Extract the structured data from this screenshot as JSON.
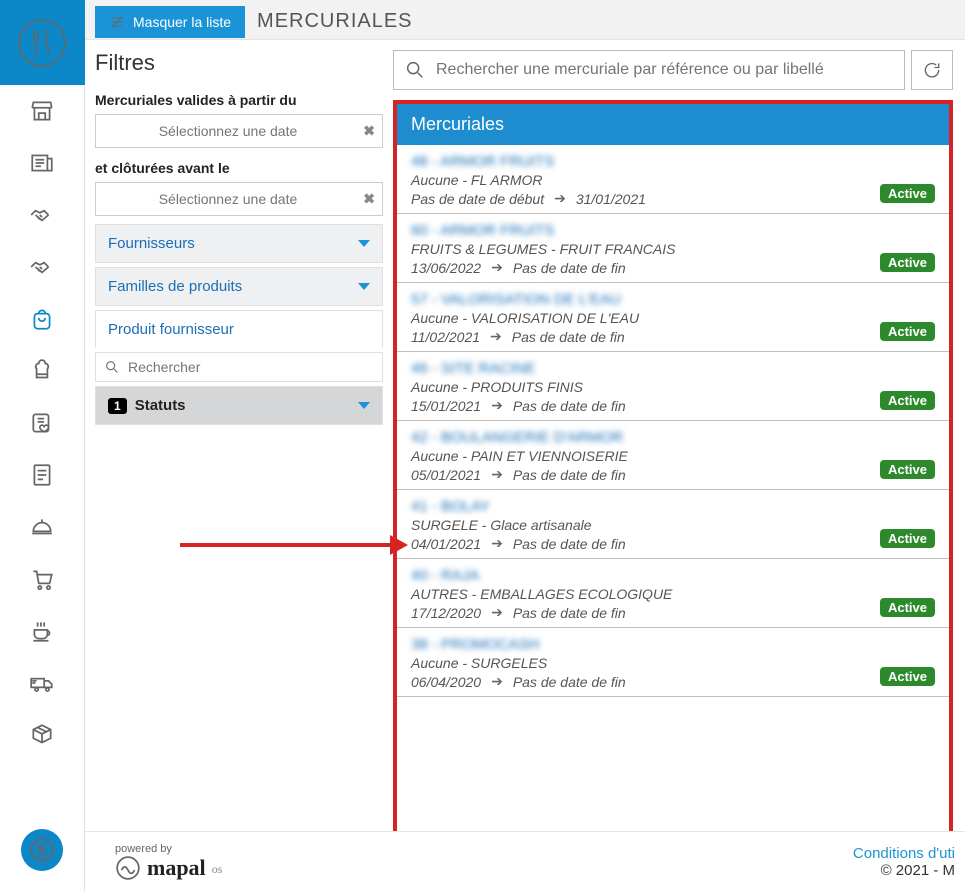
{
  "topbar": {
    "hide_list_label": "Masquer la liste",
    "page_title": "MERCURIALES"
  },
  "filters": {
    "heading": "Filtres",
    "valid_from_label": "Mercuriales valides à partir du",
    "valid_from_placeholder": "Sélectionnez une date",
    "closed_before_label": "et clôturées avant le",
    "closed_before_placeholder": "Sélectionnez une date",
    "suppliers_label": "Fournisseurs",
    "families_label": "Familles de produits",
    "supplier_product_label": "Produit fournisseur",
    "supplier_product_search_placeholder": "Rechercher",
    "status_label": "Statuts",
    "status_count": "1"
  },
  "search": {
    "placeholder": "Rechercher une mercuriale par référence ou par libellé"
  },
  "list": {
    "header": "Mercuriales",
    "no_start": "Pas de date de début",
    "no_end": "Pas de date de fin",
    "active_label": "Active",
    "items": [
      {
        "title": "48 - ARMOR FRUITS",
        "sub": "Aucune - FL ARMOR",
        "start": "",
        "end": "31/01/2021"
      },
      {
        "title": "60 - ARMOR FRUITS",
        "sub": "FRUITS & LEGUMES - FRUIT FRANCAIS",
        "start": "13/06/2022",
        "end": ""
      },
      {
        "title": "57 - VALORISATION DE L'EAU",
        "sub": "Aucune - VALORISATION DE L'EAU",
        "start": "11/02/2021",
        "end": ""
      },
      {
        "title": "46 - SITE RACINE",
        "sub": "Aucune - PRODUITS FINIS",
        "start": "15/01/2021",
        "end": ""
      },
      {
        "title": "42 - BOULANGERIE D'ARMOR",
        "sub": "Aucune - PAIN ET VIENNOISERIE",
        "start": "05/01/2021",
        "end": ""
      },
      {
        "title": "41 - BOLAY",
        "sub": "SURGELE - Glace artisanale",
        "start": "04/01/2021",
        "end": ""
      },
      {
        "title": "40 - RAJA",
        "sub": "AUTRES - EMBALLAGES ECOLOGIQUE",
        "start": "17/12/2020",
        "end": ""
      },
      {
        "title": "38 - PROMOCASH",
        "sub": "Aucune - SURGELES",
        "start": "06/04/2020",
        "end": ""
      }
    ]
  },
  "footer": {
    "powered_by": "powered by",
    "brand": "mapal",
    "brand_suffix": "os",
    "conditions": "Conditions d'uti",
    "copyright": "© 2021 - M"
  }
}
